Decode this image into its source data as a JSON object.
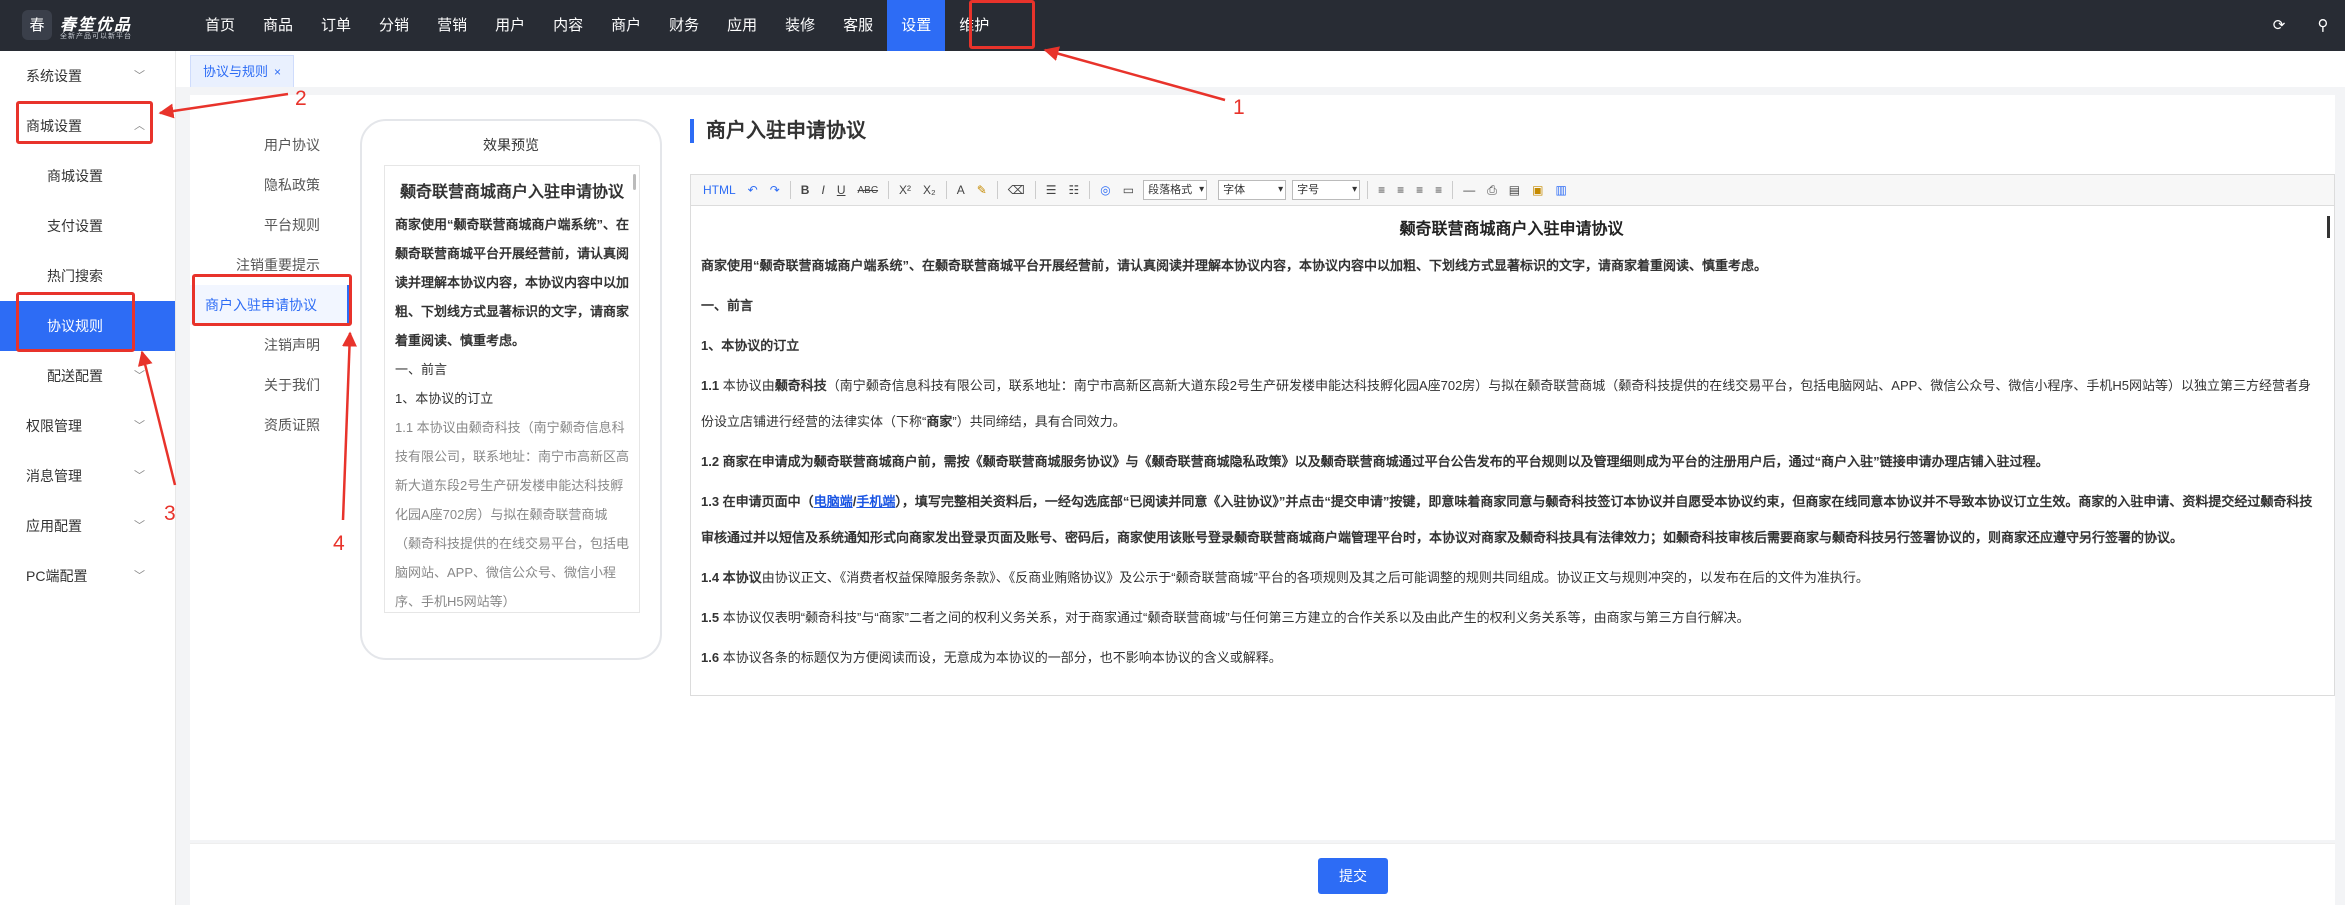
{
  "brand": {
    "title": "春笙优品",
    "subtitle": "全新产品可以新平台",
    "mark": "春"
  },
  "topnav": [
    "首页",
    "商品",
    "订单",
    "分销",
    "营销",
    "用户",
    "内容",
    "商户",
    "财务",
    "应用",
    "装修",
    "客服",
    "设置",
    "维护"
  ],
  "topnav_active": "设置",
  "top_icons": {
    "refresh": "⟳",
    "search": "⚲"
  },
  "sidebar": {
    "system": "系统设置",
    "mall": "商城设置",
    "mall_items": [
      "商城设置",
      "支付设置",
      "热门搜索",
      "协议规则",
      "配送配置"
    ],
    "other_groups": [
      "权限管理",
      "消息管理",
      "应用配置",
      "PC端配置"
    ]
  },
  "tab": {
    "label": "协议与规则",
    "close": "×"
  },
  "rules": [
    "用户协议",
    "隐私政策",
    "平台规则",
    "注销重要提示",
    "商户入驻申请协议",
    "注销声明",
    "关于我们",
    "资质证照"
  ],
  "preview": {
    "label": "效果预览",
    "title": "颡奇联营商城商户入驻申请协议",
    "lines": [
      "商家使用“颡奇联营商城商户端系统”、在颡奇联营商城平台开展经营前，请认真阅读并理解本协议内容，本协议内容中以加粗、下划线方式显著标识的文字，请商家着重阅读、慎重考虑。",
      "一、前言",
      "1、本协议的订立",
      "1.1 本协议由颡奇科技（南宁颡奇信息科技有限公司，联系地址：南宁市高新区高新大道东段2号生产研发楼申能达科技孵化园A座702房）与拟在颡奇联营商城（颡奇科技提供的在线交易平台，包括电脑网站、APP、微信公众号、微信小程序、手机H5网站等）"
    ]
  },
  "editor": {
    "heading": "商户入驻申请协议",
    "toolbar": {
      "paragraph": "段落格式",
      "font": "字体",
      "size": "字号",
      "html": "HTML",
      "bold": "B",
      "italic": "I",
      "underline": "U",
      "strike": "ABC",
      "sup": "X²",
      "sub": "X₂",
      "color": "A"
    },
    "doc_title": "颡奇联营商城商户入驻申请协议",
    "intro": "商家使用“颡奇联营商城商户端系统”、在颡奇联营商城平台开展经营前，请认真阅读并理解本协议内容，本协议内容中以加粗、下划线方式显著标识的文字，请商家着重阅读、慎重考虑。",
    "sec1": "一、前言",
    "sec1_1": "1、本协议的订立",
    "p11_label": "1.1",
    "p11_a": " 本协议由",
    "p11_b": "颡奇科技",
    "p11_c": "（南宁颡奇信息科技有限公司，联系地址：南宁市高新区高新大道东段2号生产研发楼申能达科技孵化园A座702房）与拟在颡奇联营商城（颡奇科技提供的在线交易平台，包括电脑网站、APP、微信公众号、微信小程序、手机H5网站等）以独立第三方经营者身份设立店铺进行经营的法律实体（下称“",
    "p11_d": "商家",
    "p11_e": "”）共同缔结，具有合同效力。",
    "p12": "1.2 商家在申请成为颡奇联营商城商户前，需按《颡奇联营商城服务协议》与《颡奇联营商城隐私政策》以及颡奇联营商城通过平台公告发布的平台规则以及管理细则成为平台的注册用户后，通过“商户入驻”链接申请办理店铺入驻过程。",
    "p13_a": "1.3 在申请页面中（",
    "p13_link1": "电脑端",
    "p13_slash": "/",
    "p13_link2": "手机端",
    "p13_b": "），填写完整相关资料后，一经勾选底部“已阅读并同意《入驻协议》”并点击“提交申请”按键，即意味着商家同意与颡奇科技签订本协议并自愿受本协议约束，但商家在线同意本协议并不导致本协议订立生效。商家的入驻申请、资料提交经过颡奇科技审核通过并以短信及系统通知形式向商家发出登录页面及账号、密码后，商家使用该账号登录颡奇联营商城商户端管理平台时，本协议对商家及颡奇科技具有法律效力；如颡奇科技审核后需要商家与颡奇科技另行签署协议的，则商家还应遵守另行签署的协议。",
    "p14_label": "1.4 本协议",
    "p14": "由协议正文、《消费者权益保障服务条款》、《反商业贿赂协议》及公示于“颡奇联营商城”平台的各项规则及其之后可能调整的规则共同组成。协议正文与规则冲突的，以发布在后的文件为准执行。",
    "p15_label": "1.5",
    "p15": " 本协议仅表明“颡奇科技”与“商家”二者之间的权利义务关系，对于商家通过“颡奇联营商城”与任何第三方建立的合作关系以及由此产生的权利义务关系等，由商家与第三方自行解决。",
    "p16_label": "1.6",
    "p16": " 本协议各条的标题仅为方便阅读而设，无意成为本协议的一部分，也不影响本协议的含义或解释。"
  },
  "submit": "提交",
  "annotations": [
    "1",
    "2",
    "3",
    "4"
  ],
  "accent": "#2d6cf5",
  "annotation_color": "#e8332b"
}
